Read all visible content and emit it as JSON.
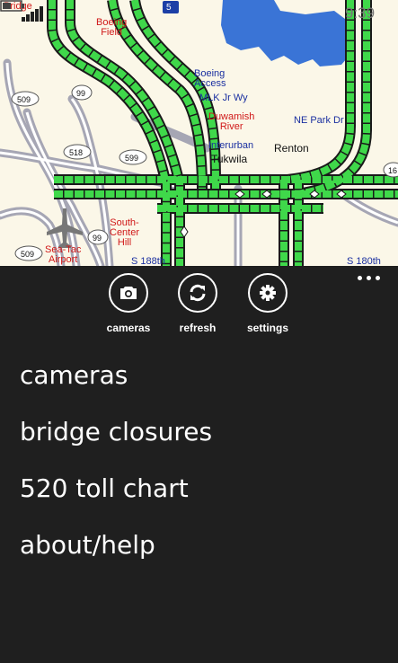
{
  "status_bar": {
    "time": "9:39"
  },
  "map": {
    "labels": {
      "bridge": "Bridge",
      "boeing_field": "Boeing\nField",
      "i5": "5",
      "boeing_access": "Boeing\nAccess",
      "mlk": "MLK Jr Wy",
      "duwamish": "Duwamish\nRiver",
      "ne_park": "NE Park Dr",
      "interurban": "Interurban",
      "tukwila": "Tukwila",
      "renton": "Renton",
      "r509a": "509",
      "r99a": "99",
      "r518": "518",
      "r599": "599",
      "r16": "16",
      "southcenter": "South-\nCenter\nHill",
      "r99b": "99",
      "r509b": "509",
      "seatac": "Sea-Tac\nAirport",
      "s188": "S 188th",
      "s180": "S 180th"
    }
  },
  "app_bar": {
    "buttons": [
      {
        "label": "cameras",
        "icon": "camera-icon"
      },
      {
        "label": "refresh",
        "icon": "refresh-icon"
      },
      {
        "label": "settings",
        "icon": "gear-icon"
      }
    ]
  },
  "menu": {
    "items": [
      "cameras",
      "bridge closures",
      "520 toll chart",
      "about/help"
    ]
  }
}
